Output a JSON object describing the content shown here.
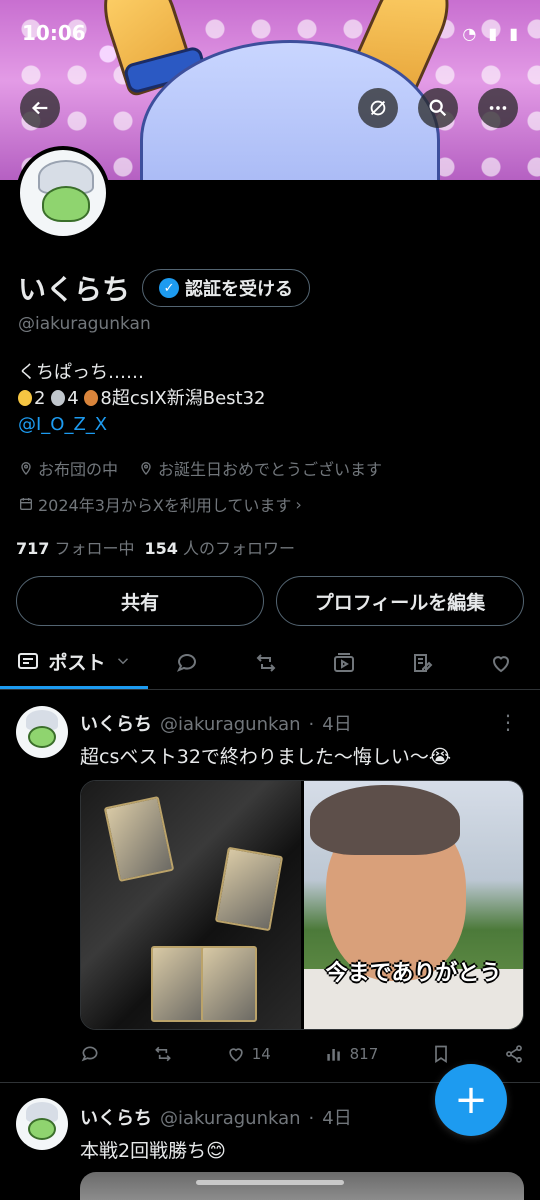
{
  "status_bar": {
    "time": "10:06"
  },
  "profile": {
    "display_name": "いくらち",
    "verify_label": "認証を受ける",
    "handle": "@iakuragunkan",
    "bio_line1": "くちぱっち……",
    "bio_line2_medals": "2  4  8超csIX新潟Best32",
    "bio_line2_gold": "2",
    "bio_line2_silver": "4",
    "bio_line2_rest": "8超csIX新潟Best32",
    "bio_link": "@I_O_Z_X",
    "location": "お布団の中",
    "birthday": "お誕生日おめでとうございます",
    "joined": "2024年3月からXを利用しています",
    "following_count": "717",
    "following_label": "フォロー中",
    "followers_count": "154",
    "followers_label": "人のフォロワー"
  },
  "buttons": {
    "share": "共有",
    "edit_profile": "プロフィールを編集"
  },
  "tabs": {
    "posts": "ポスト"
  },
  "posts": [
    {
      "name": "いくらち",
      "handle": "@iakuragunkan",
      "time": "4日",
      "text": "超csベスト32で終わりました〜悔しい〜😭",
      "media_caption": "今までありがとう",
      "likes": "14",
      "views": "817"
    },
    {
      "name": "いくらち",
      "handle": "@iakuragunkan",
      "time": "4日",
      "text": "本戦2回戦勝ち😊"
    }
  ],
  "colors": {
    "accent": "#1d9bf0",
    "background": "#000000",
    "muted": "#71767b"
  }
}
